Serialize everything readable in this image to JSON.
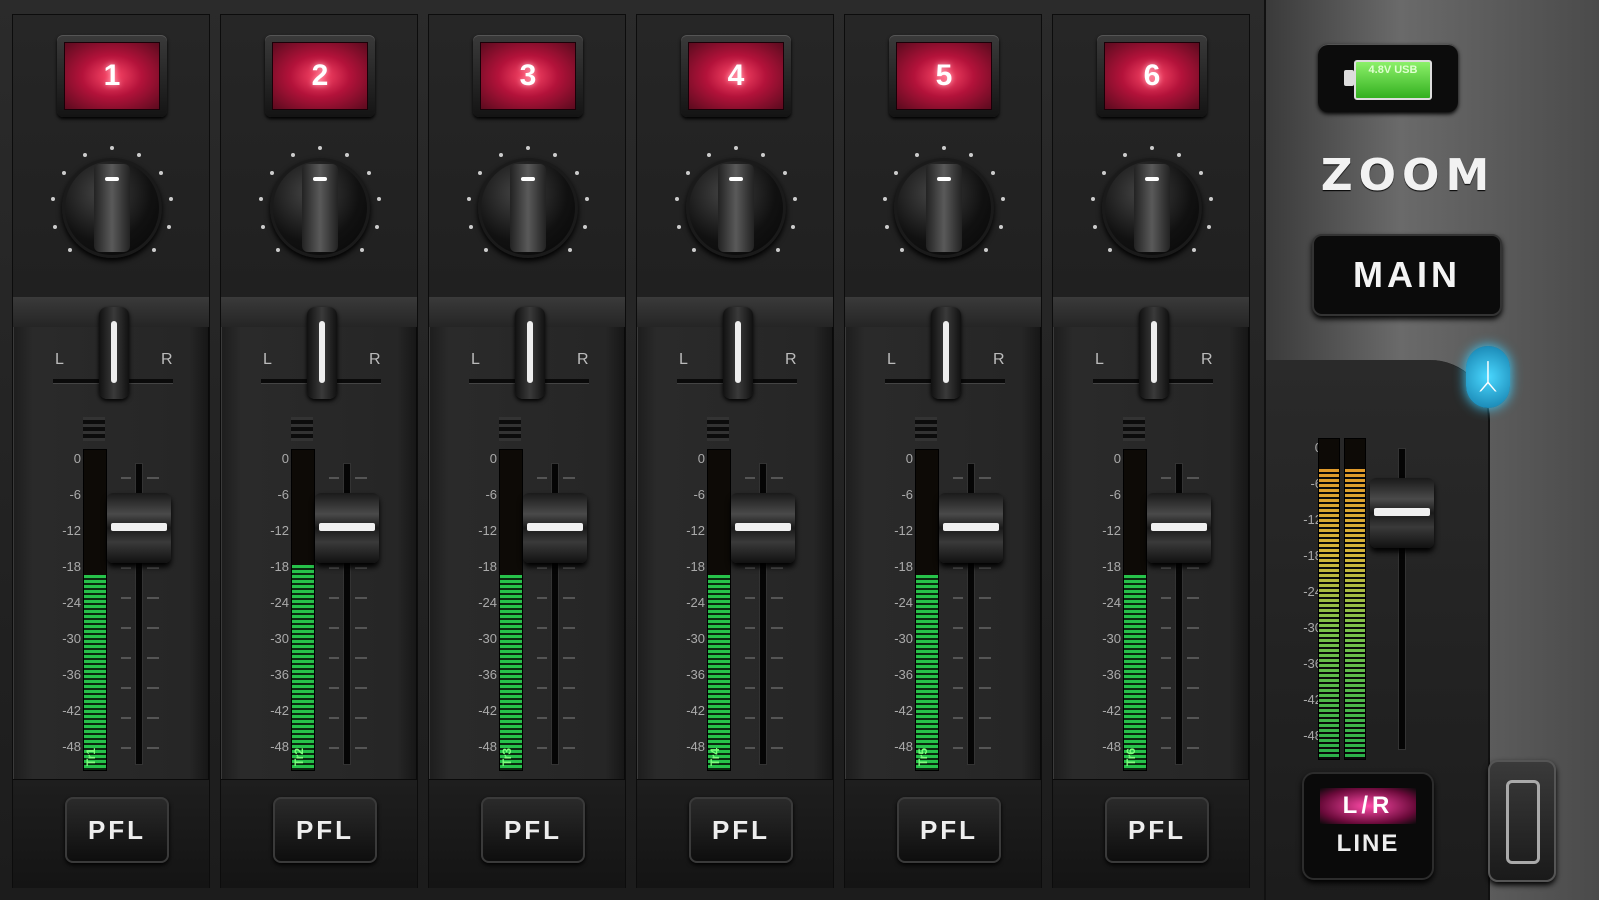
{
  "channels": [
    {
      "number": "1",
      "track": "Tr1",
      "pfl": "PFL",
      "level": 0.61
    },
    {
      "number": "2",
      "track": "Tr2",
      "pfl": "PFL",
      "level": 0.64
    },
    {
      "number": "3",
      "track": "Tr3",
      "pfl": "PFL",
      "level": 0.61
    },
    {
      "number": "4",
      "track": "Tr4",
      "pfl": "PFL",
      "level": 0.61
    },
    {
      "number": "5",
      "track": "Tr5",
      "pfl": "PFL",
      "level": 0.61
    },
    {
      "number": "6",
      "track": "Tr6",
      "pfl": "PFL",
      "level": 0.61
    }
  ],
  "pan_labels": {
    "left": "L",
    "right": "R"
  },
  "meter_scale": [
    "0",
    "-6",
    "-12",
    "-18",
    "-24",
    "-30",
    "-36",
    "-42",
    "-48"
  ],
  "master": {
    "battery_text": "4.8V USB",
    "brand": "ZOOM",
    "main_label": "MAIN",
    "lr_label": "L/R",
    "line_label": "LINE",
    "bluetooth_icon": "bluetooth-icon"
  },
  "colors": {
    "channel_button": "#c0143c",
    "meter_green": "#27c24a",
    "bluetooth": "#3cd0ff"
  }
}
